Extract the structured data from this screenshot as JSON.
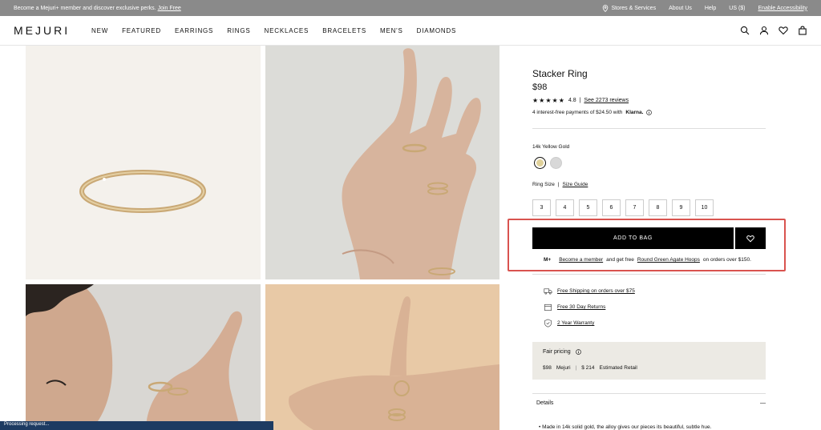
{
  "promo": {
    "text": "Become a Mejuri+ member and discover exclusive perks.",
    "link": "Join Free",
    "stores": "Stores & Services",
    "about": "About Us",
    "help": "Help",
    "region": "US ($)",
    "accessibility": "Enable Accessibility"
  },
  "nav": {
    "logo": "MEJURI",
    "items": [
      "NEW",
      "FEATURED",
      "EARRINGS",
      "RINGS",
      "NECKLACES",
      "BRACELETS",
      "MEN'S",
      "DIAMONDS"
    ]
  },
  "product": {
    "title": "Stacker Ring",
    "price": "$98",
    "rating": "4.8",
    "reviews": "See 2273 reviews",
    "klarna_text": "4 interest-free payments of $24.50 with",
    "klarna_brand": "Klarna.",
    "metal": "14k Yellow Gold",
    "ring_size_label": "Ring Size",
    "size_guide": "Size Guide",
    "sizes": [
      "3",
      "4",
      "5",
      "6",
      "7",
      "8",
      "9",
      "10"
    ],
    "add_to_bag": "ADD TO BAG"
  },
  "member": {
    "prefix": "M+",
    "link": "Become a member",
    "middle": "and get free",
    "gift": "Round Green Agate Hoops",
    "suffix": "on orders over $150."
  },
  "perks": {
    "shipping": "Free Shipping on orders over $75",
    "returns": "Free 30 Day Returns",
    "warranty": "2 Year Warranty"
  },
  "fair": {
    "title": "Fair pricing",
    "our_price": "$98",
    "brand": "Mejuri",
    "retail_price": "$ 214",
    "retail_label": "Estimated Retail"
  },
  "details": {
    "title": "Details",
    "bullet": "• Made in 14k solid gold, the alloy gives our pieces its beautiful, subtle hue."
  },
  "status": "Processing request..."
}
